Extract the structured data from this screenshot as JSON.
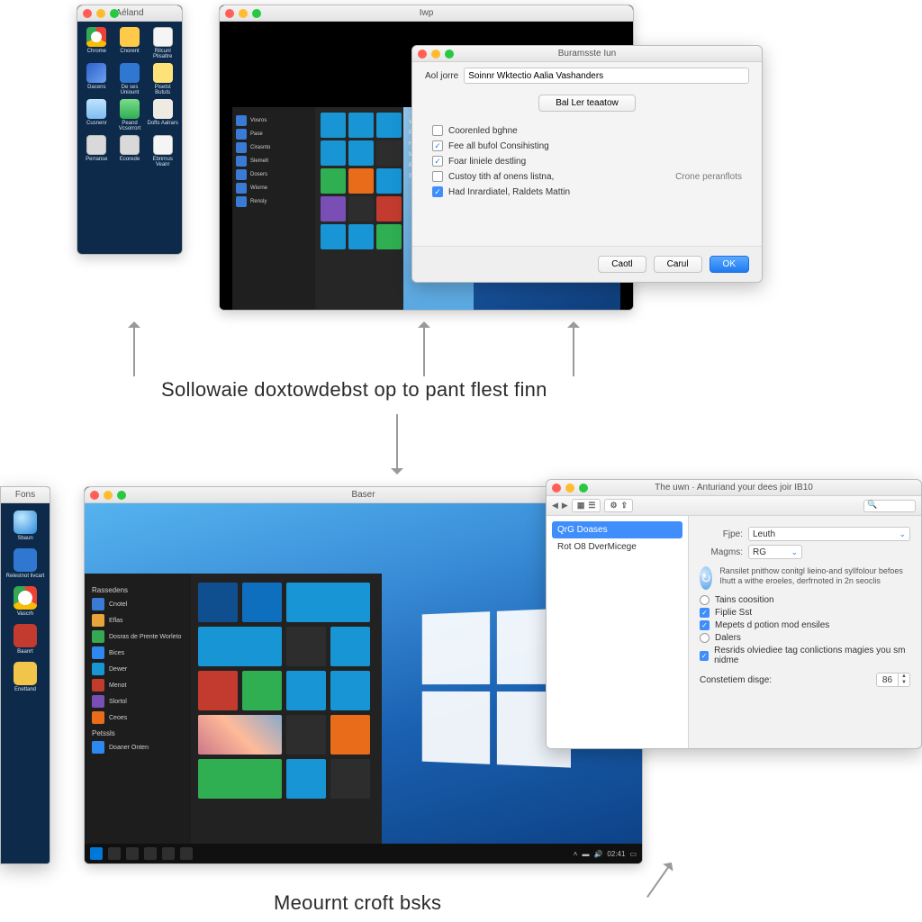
{
  "captions": {
    "middle": "Sollowaie doxtowdebst op to pant flest finn",
    "bottom": "Meournt croft bsks"
  },
  "sidebar1": {
    "title": "Aéland",
    "apps": [
      {
        "label": "Chrome",
        "icon": "chrome"
      },
      {
        "label": "Cnorent",
        "icon": "folder"
      },
      {
        "label": "Rilcunl Plisaltre",
        "icon": "doc"
      },
      {
        "label": "Dacens",
        "icon": "pen"
      },
      {
        "label": "De ses Uniount",
        "icon": "blue"
      },
      {
        "label": "Pisetst Bututs",
        "icon": "note"
      },
      {
        "label": "Cusnenr",
        "icon": "cloud"
      },
      {
        "label": "Peand Vcsorrort",
        "icon": "shield"
      },
      {
        "label": "Dofts Aalrars",
        "icon": "paper"
      },
      {
        "label": "Perranse",
        "icon": "grey"
      },
      {
        "label": "Ecorede",
        "icon": "grey"
      },
      {
        "label": "Ebnrnus Veanr",
        "icon": "doc"
      }
    ]
  },
  "vm1": {
    "title": "Iwp",
    "start_list": [
      "Vosros",
      "Pase",
      "Cirasnto",
      "Slemelt",
      "Dosers",
      "Wiorne",
      "Rensly"
    ],
    "sidepanel": [
      "Vlome",
      "Pictres",
      "Hures",
      "Music",
      "Biromy",
      "S1 sw"
    ],
    "tiles": [
      "#1795d4",
      "#1795d4",
      "#1795d4",
      "#1795d4",
      "#1795d4",
      "#2d2d2d",
      "#2fae52",
      "#e86c1a",
      "#1795d4",
      "#7a4fb5",
      "#2d2d2d",
      "#c23b2e",
      "#1795d4",
      "#1795d4",
      "#2fae52"
    ]
  },
  "dlg1": {
    "title": "Buramsste Iun",
    "name_label": "Aol jorre",
    "name_value": "Soinnr Wktectio Aalia Vashanders",
    "wide_button": "Bal Ler teaatow",
    "options": [
      {
        "checked": false,
        "label": "Coorenled bghne"
      },
      {
        "checked": true,
        "label": "Fee all bufol Consihisting"
      },
      {
        "checked": true,
        "label": "Foar liniele destling"
      },
      {
        "checked": false,
        "label": "Custoy tith af onens listna,"
      },
      {
        "checked": true,
        "label": "Had Inrardiatel, Raldets Mattin",
        "blue": true
      }
    ],
    "link": "Crone peranflots",
    "buttons": {
      "cancel": "Caotl",
      "cancel2": "Carul",
      "ok": "OK"
    }
  },
  "sidebar2": {
    "title": "Fons",
    "apps": [
      {
        "label": "Sbaun",
        "icon": "globe"
      },
      {
        "label": "Relestnot livcart",
        "icon": "blue"
      },
      {
        "label": "Vascrh",
        "icon": "chrome"
      },
      {
        "label": "Baanrt",
        "icon": "red"
      },
      {
        "label": "Enettand",
        "icon": "ylw"
      }
    ]
  },
  "vm2": {
    "title": "Baser",
    "start": {
      "header_recent": "Rassedens",
      "header_pinned": "Petssls",
      "recent": [
        {
          "label": "Cnotel",
          "color": "#3a7bd5"
        },
        {
          "label": "Eflas",
          "color": "#e8a33a"
        },
        {
          "label": "Dosras de Prente Worleto",
          "color": "#34a853"
        },
        {
          "label": "Bices",
          "color": "#2d89ef"
        },
        {
          "label": "Dewer",
          "color": "#1795d4"
        },
        {
          "label": "Menot",
          "color": "#c23b2e"
        },
        {
          "label": "Slortol",
          "color": "#7a4fb5"
        },
        {
          "label": "Ceoes",
          "color": "#e86c1a"
        }
      ],
      "pinned": [
        {
          "label": "Doaner Onten",
          "color": "#2d89ef"
        }
      ],
      "tiles": [
        {
          "c": "#0f4f8f",
          "w": 1
        },
        {
          "c": "#0f6fbf",
          "w": 1
        },
        {
          "c": "#1795d4",
          "w": 2
        },
        {
          "c": "#1795d4",
          "w": 2
        },
        {
          "c": "#2d2d2d",
          "w": 1
        },
        {
          "c": "#1795d4",
          "w": 1
        },
        {
          "c": "#c23b2e",
          "w": 1
        },
        {
          "c": "#2fae52",
          "w": 1
        },
        {
          "c": "#1795d4",
          "w": 1
        },
        {
          "c": "#1795d4",
          "w": 1
        },
        {
          "c": "photo",
          "w": 2
        },
        {
          "c": "#2d2d2d",
          "w": 1
        },
        {
          "c": "#e86c1a",
          "w": 1
        },
        {
          "c": "#2fae52",
          "w": 2
        },
        {
          "c": "#1795d4",
          "w": 1
        },
        {
          "c": "#2d2d2d",
          "w": 1
        }
      ]
    },
    "taskbar_time": "02:41"
  },
  "dlg2": {
    "title": "The uwn · Anturiand your dees joir IB10",
    "list": [
      "QrG Doases",
      "Rot O8 DverMicege"
    ],
    "field_name": {
      "label": "Fjpe:",
      "value": "Leuth"
    },
    "field_map": {
      "label": "Magms:",
      "value": "RG"
    },
    "info": "Ransilet pnithow conitgl lieino-and syllfolour befoes Ihutt a withe eroeles, derfrnoted in 2n seoclis",
    "options": [
      {
        "kind": "radio",
        "checked": false,
        "label": "Tains coosition"
      },
      {
        "kind": "check",
        "checked": true,
        "label": "Fiplie Sst"
      },
      {
        "kind": "check",
        "checked": true,
        "label": "Mepets d potion mod ensiles"
      },
      {
        "kind": "radio",
        "checked": false,
        "label": "Dalers"
      },
      {
        "kind": "check",
        "checked": true,
        "label": "Resrids olviediee tag conlictions magies you sm nidme"
      }
    ],
    "stepper": {
      "label": "Constetiem disge:",
      "value": "86"
    }
  }
}
